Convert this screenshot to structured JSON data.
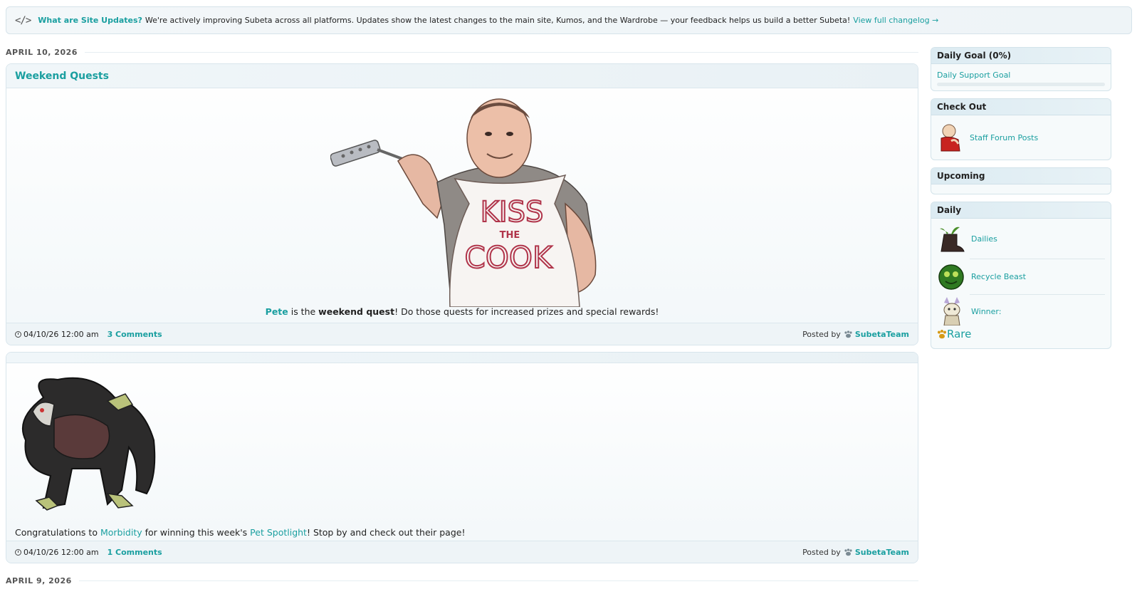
{
  "banner": {
    "icon": "code-icon",
    "question": "What are Site Updates?",
    "text": "We're actively improving Subeta across all platforms. Updates show the latest changes to the main site, Kumos, and the Wardrobe — your feedback helps us build a better Subeta!",
    "link": "View full changelog →"
  },
  "dates": [
    "APRIL 10, 2026",
    "APRIL 9, 2026"
  ],
  "posts": [
    {
      "title": "Weekend Quests",
      "image_alt": "Pete — KISS THE COOK",
      "apron_text_1": "KISS",
      "apron_text_2": "THE",
      "apron_text_3": "COOK",
      "caption_link": "Pete",
      "caption_mid": " is the ",
      "caption_bold": "weekend quest",
      "caption_end": "! Do those quests for increased prizes and special rewards!",
      "timestamp": "04/10/26 12:00 am",
      "comments": "3 Comments",
      "posted_by": "Posted by",
      "author": "SubetaTeam"
    },
    {
      "title": "",
      "caption_start": "Congratulations to ",
      "caption_link1": "Morbidity",
      "caption_mid": " for winning this week's ",
      "caption_link2": "Pet Spotlight",
      "caption_end": "! Stop by and check out their page!",
      "timestamp": "04/10/26 12:00 am",
      "comments": "1 Comments",
      "posted_by": "Posted by",
      "author": "SubetaTeam"
    }
  ],
  "sidebar": {
    "daily_goal": {
      "title": "Daily Goal (0%)",
      "link": "Daily Support Goal",
      "progress": 0
    },
    "check_out": {
      "title": "Check Out",
      "items": [
        {
          "label": "Staff Forum Posts",
          "icon": "staff-avatar-icon"
        }
      ]
    },
    "upcoming": {
      "title": "Upcoming"
    },
    "daily": {
      "title": "Daily",
      "items": [
        {
          "label": "Dailies",
          "icon": "boot-plant-icon"
        },
        {
          "label": "Recycle Beast",
          "icon": "recycle-beast-icon"
        },
        {
          "label": "Winner:",
          "icon": "winner-pet-icon"
        }
      ],
      "rarity": "Rare"
    }
  },
  "colors": {
    "accent": "#1a9fa0",
    "header_bg": "#dcebf2"
  }
}
